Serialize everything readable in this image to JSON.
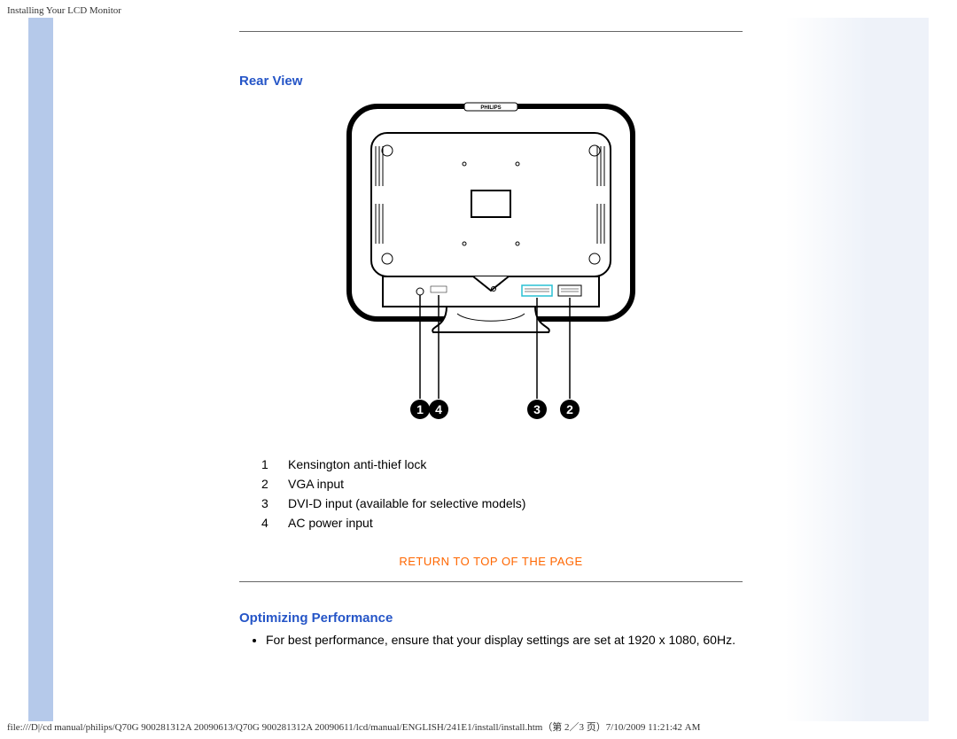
{
  "header": {
    "doc_title": "Installing Your LCD Monitor"
  },
  "sections": {
    "rear_view": {
      "title": "Rear View",
      "brand_label": "PHILIPS",
      "callouts": [
        "1",
        "4",
        "3",
        "2"
      ],
      "legend": [
        {
          "n": "1",
          "text": "Kensington anti-thief lock"
        },
        {
          "n": "2",
          "text": "VGA input"
        },
        {
          "n": "3",
          "text": "DVI-D input (available for selective models)"
        },
        {
          "n": "4",
          "text": "AC power input"
        }
      ],
      "return_link": "RETURN TO TOP OF THE PAGE"
    },
    "optimizing": {
      "title": "Optimizing Performance",
      "bullets": [
        "For best performance, ensure that your display settings are set at 1920 x 1080, 60Hz."
      ]
    }
  },
  "footer": {
    "path": "file:///D|/cd manual/philips/Q70G 900281312A 20090613/Q70G 900281312A 20090611/lcd/manual/ENGLISH/241E1/install/install.htm（第 2／3 页）7/10/2009 11:21:42 AM"
  }
}
